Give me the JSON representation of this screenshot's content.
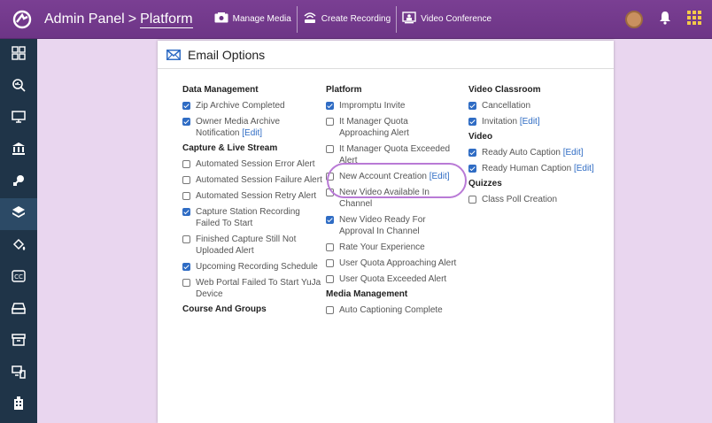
{
  "header": {
    "breadcrumb": [
      "Admin Panel",
      "Platform"
    ],
    "breadcrumb_sep": ">",
    "buttons": [
      {
        "label": "Manage Media",
        "icon": "media-icon"
      },
      {
        "label": "Create Recording",
        "icon": "recording-icon"
      },
      {
        "label": "Video Conference",
        "icon": "video-conference-icon"
      }
    ]
  },
  "sidebar": {
    "items": [
      {
        "icon": "dashboard-grid-icon",
        "active": false
      },
      {
        "icon": "analytics-search-icon",
        "active": false
      },
      {
        "icon": "monitor-icon",
        "active": false
      },
      {
        "icon": "institution-icon",
        "active": false
      },
      {
        "icon": "integration-plug-icon",
        "active": false
      },
      {
        "icon": "platform-layers-icon",
        "active": true
      },
      {
        "icon": "paint-bucket-icon",
        "active": false
      },
      {
        "icon": "closed-caption-icon",
        "active": false
      },
      {
        "icon": "storage-drive-icon",
        "active": false
      },
      {
        "icon": "archive-box-icon",
        "active": false
      },
      {
        "icon": "devices-icon",
        "active": false
      },
      {
        "icon": "building-icon",
        "active": false
      }
    ]
  },
  "panel": {
    "title": "Email Options",
    "edit_label": "[Edit]",
    "columns": [
      {
        "sections": [
          {
            "title": "Data Management",
            "options": [
              {
                "label": "Zip Archive Completed",
                "checked": true,
                "edit": false
              },
              {
                "label": "Owner Media Archive Notification",
                "checked": true,
                "edit": true
              }
            ]
          },
          {
            "title": "Capture & Live Stream",
            "options": [
              {
                "label": "Automated Session Error Alert",
                "checked": false,
                "edit": false
              },
              {
                "label": "Automated Session Failure Alert",
                "checked": false,
                "edit": false
              },
              {
                "label": "Automated Session Retry Alert",
                "checked": false,
                "edit": false
              },
              {
                "label": "Capture Station Recording Failed To Start",
                "checked": true,
                "edit": false
              },
              {
                "label": "Finished Capture Still Not Uploaded Alert",
                "checked": false,
                "edit": false
              },
              {
                "label": "Upcoming Recording Schedule",
                "checked": true,
                "edit": false
              },
              {
                "label": "Web Portal Failed To Start YuJa Device",
                "checked": false,
                "edit": false
              }
            ]
          },
          {
            "title": "Course And Groups",
            "options": []
          }
        ]
      },
      {
        "sections": [
          {
            "title": "Platform",
            "options": [
              {
                "label": "Impromptu Invite",
                "checked": true,
                "edit": false
              },
              {
                "label": "It Manager Quota Approaching Alert",
                "checked": false,
                "edit": false
              },
              {
                "label": "It Manager Quota Exceeded Alert",
                "checked": false,
                "edit": false
              },
              {
                "label": "New Account Creation",
                "checked": false,
                "edit": true
              },
              {
                "label": "New Video Available In Channel",
                "checked": false,
                "edit": false
              },
              {
                "label": "New Video Ready For Approval In Channel",
                "checked": true,
                "edit": false
              },
              {
                "label": "Rate Your Experience",
                "checked": false,
                "edit": false
              },
              {
                "label": "User Quota Approaching Alert",
                "checked": false,
                "edit": false
              },
              {
                "label": "User Quota Exceeded Alert",
                "checked": false,
                "edit": false
              }
            ]
          },
          {
            "title": "Media Management",
            "options": [
              {
                "label": "Auto Captioning Complete",
                "checked": false,
                "edit": false
              }
            ]
          }
        ]
      },
      {
        "sections": [
          {
            "title": "Video Classroom",
            "options": [
              {
                "label": "Cancellation",
                "checked": true,
                "edit": false
              },
              {
                "label": "Invitation",
                "checked": true,
                "edit": true
              }
            ]
          },
          {
            "title": "Video",
            "options": [
              {
                "label": "Ready Auto Caption",
                "checked": true,
                "edit": true
              },
              {
                "label": "Ready Human Caption",
                "checked": true,
                "edit": true
              }
            ]
          },
          {
            "title": "Quizzes",
            "options": [
              {
                "label": "Class Poll Creation",
                "checked": false,
                "edit": false
              }
            ]
          }
        ]
      }
    ]
  },
  "colors": {
    "topbar": "#6d3586",
    "sidebar": "#1f3448",
    "background": "#e9d6ef",
    "checkbox_checked": "#2f6cc4",
    "highlight": "#b97ad6"
  }
}
